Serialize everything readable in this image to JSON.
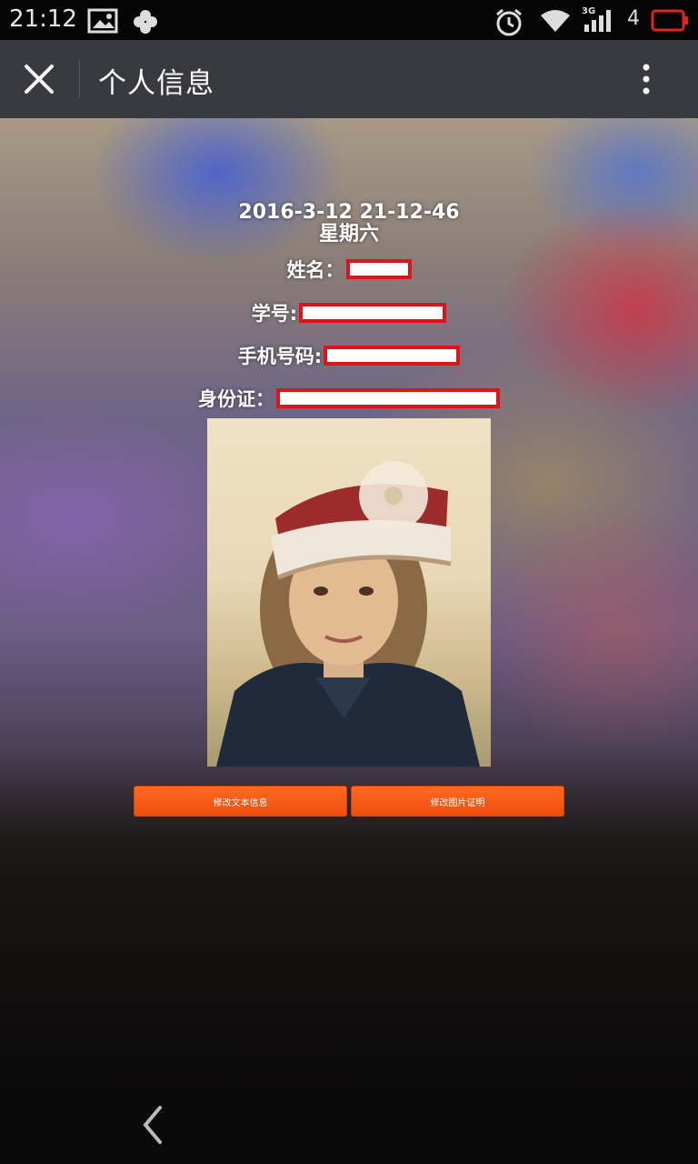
{
  "status_bar": {
    "time": "21:12",
    "network": "3G",
    "signal_number": "4",
    "icons": [
      "image-icon",
      "clover-icon",
      "alarm-icon",
      "wifi-icon",
      "signal-icon",
      "battery-icon"
    ]
  },
  "header": {
    "title": "个人信息",
    "close_icon": "close-icon",
    "more_icon": "more-vertical-icon"
  },
  "info": {
    "datetime": "2016-3-12 21-12-46",
    "weekday": "星期六",
    "fields": [
      {
        "label": "姓名：",
        "value_redacted": true
      },
      {
        "label": "学号:",
        "value_redacted": true
      },
      {
        "label": "手机号码:",
        "value_redacted": true
      },
      {
        "label": "身份证：",
        "value_redacted": true
      }
    ]
  },
  "buttons": {
    "edit_text": "修改文本信息",
    "edit_photo": "修改图片证明"
  },
  "colors": {
    "title_bar": "#393a3f",
    "button": "#f25714",
    "redact_border": "#e2121b"
  }
}
